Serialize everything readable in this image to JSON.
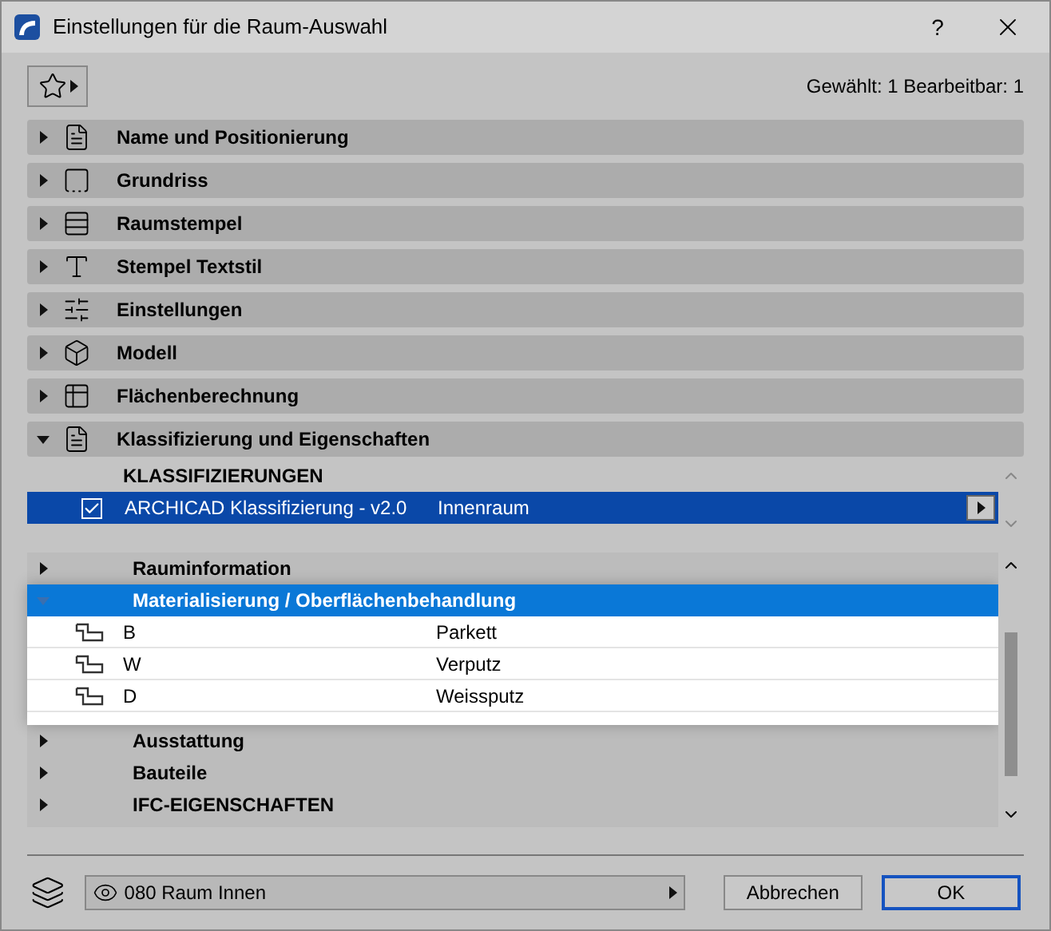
{
  "window": {
    "title": "Einstellungen für die Raum-Auswahl",
    "help": "?"
  },
  "toolbar": {
    "status": "Gewählt: 1 Bearbeitbar: 1"
  },
  "sections": [
    {
      "label": "Name und Positionierung",
      "expanded": false
    },
    {
      "label": "Grundriss",
      "expanded": false
    },
    {
      "label": "Raumstempel",
      "expanded": false
    },
    {
      "label": "Stempel Textstil",
      "expanded": false
    },
    {
      "label": "Einstellungen",
      "expanded": false
    },
    {
      "label": "Modell",
      "expanded": false
    },
    {
      "label": "Flächenberechnung",
      "expanded": false
    },
    {
      "label": "Klassifizierung und Eigenschaften",
      "expanded": true
    }
  ],
  "classifications": {
    "heading": "KLASSIFIZIERUNGEN",
    "rows": [
      {
        "name": "ARCHICAD Klassifizierung - v2.0",
        "value": "Innenraum",
        "checked": true,
        "selected": true
      }
    ]
  },
  "properties": [
    {
      "label": "Rauminformation",
      "expanded": false,
      "selected": false
    },
    {
      "label": "Materialisierung / Oberflächenbehandlung",
      "expanded": true,
      "selected": true,
      "children": [
        {
          "name": "B",
          "value": "Parkett"
        },
        {
          "name": "W",
          "value": "Verputz"
        },
        {
          "name": "D",
          "value": "Weissputz"
        }
      ]
    },
    {
      "label": "Ausstattung",
      "expanded": false,
      "selected": false
    },
    {
      "label": "Bauteile",
      "expanded": false,
      "selected": false
    },
    {
      "label": "IFC-EIGENSCHAFTEN",
      "expanded": false,
      "selected": false
    }
  ],
  "footer": {
    "layer": "080 Raum Innen",
    "buttons": [
      {
        "label": "Abbrechen",
        "default": false
      },
      {
        "label": "OK",
        "default": true
      }
    ]
  }
}
